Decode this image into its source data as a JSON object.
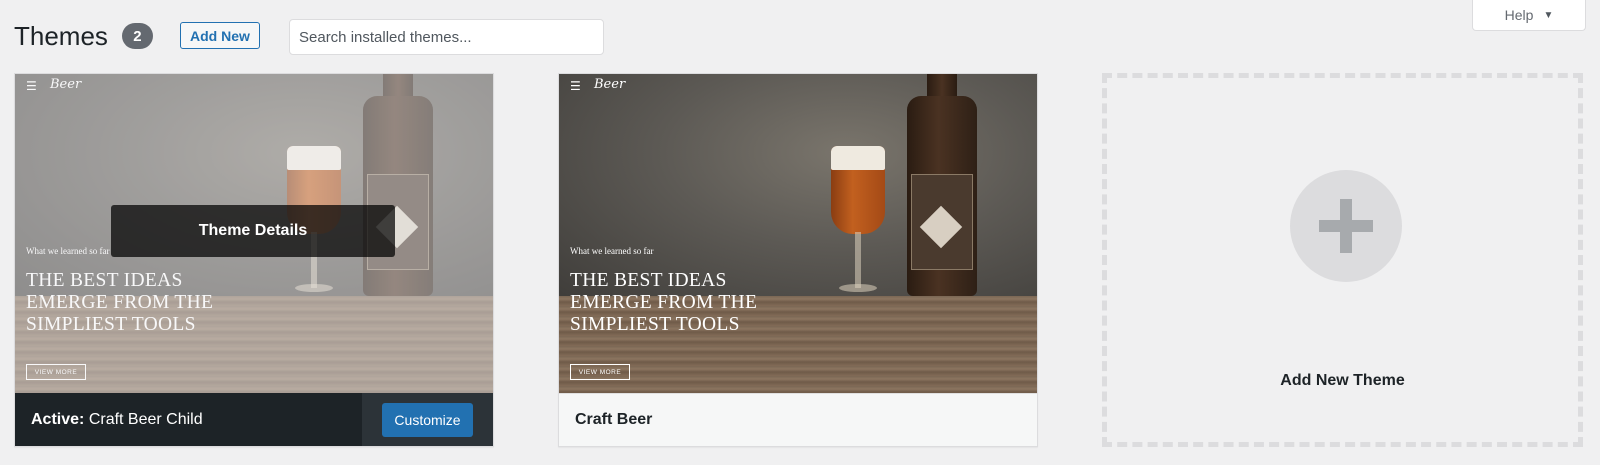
{
  "header": {
    "title": "Themes",
    "count": "2",
    "add_new_label": "Add New",
    "search_placeholder": "Search installed themes...",
    "help_label": "Help"
  },
  "themes": [
    {
      "name": "Craft Beer Child",
      "active": true,
      "active_prefix": "Active:",
      "details_label": "Theme Details",
      "customize_label": "Customize",
      "preview": {
        "kicker": "What we learned so far",
        "headline": "THE BEST IDEAS EMERGE FROM THE SIMPLIEST TOOLS",
        "button": "VIEW MORE",
        "logo": "Beer"
      }
    },
    {
      "name": "Craft Beer",
      "active": false,
      "preview": {
        "kicker": "What we learned so far",
        "headline": "THE BEST IDEAS EMERGE FROM THE SIMPLIEST TOOLS",
        "button": "VIEW MORE",
        "logo": "Beer"
      }
    }
  ],
  "add_new_theme": {
    "label": "Add New Theme"
  },
  "colors": {
    "accent": "#2271b1",
    "active_bar": "#1d2327",
    "badge": "#646970",
    "background": "#f0f0f1"
  }
}
